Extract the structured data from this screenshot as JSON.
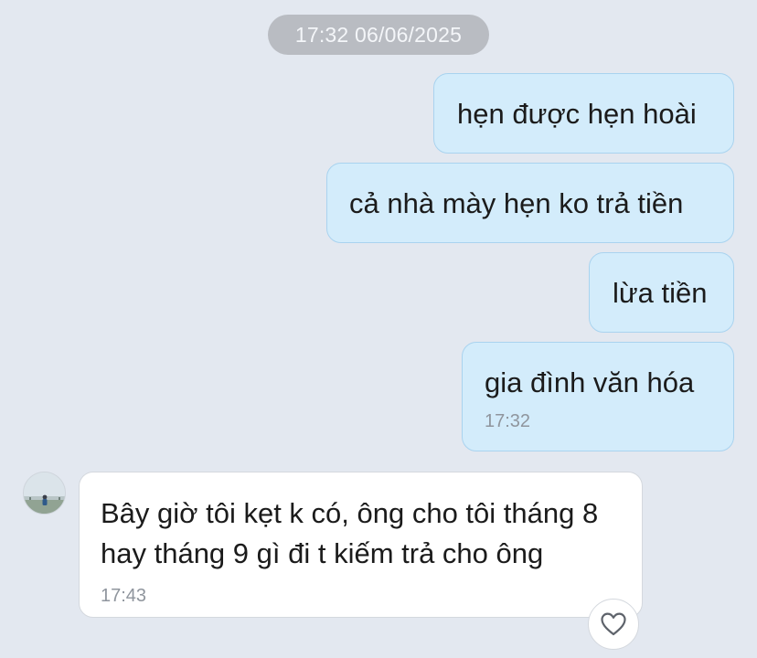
{
  "conversation": {
    "date_separator": "17:32 06/06/2025",
    "messages": [
      {
        "direction": "outgoing",
        "text": "hẹn được hẹn hoài"
      },
      {
        "direction": "outgoing",
        "text": "cả nhà mày hẹn ko trả tiền"
      },
      {
        "direction": "outgoing",
        "text": "lừa tiền"
      },
      {
        "direction": "outgoing",
        "text": "gia đình văn hóa",
        "time": "17:32"
      },
      {
        "direction": "incoming",
        "text": "Bây giờ tôi kẹt k có, ông cho tôi tháng 8 hay tháng 9 gì đi t kiếm trả cho ông",
        "time": "17:43"
      }
    ]
  },
  "icons": {
    "avatar": "contact-avatar",
    "reaction": "heart-outline-icon"
  },
  "colors": {
    "background": "#e3e8f0",
    "outgoing_bubble": "#d3ecfb",
    "incoming_bubble": "#ffffff",
    "timestamp_pill": "#b9bcc2"
  }
}
